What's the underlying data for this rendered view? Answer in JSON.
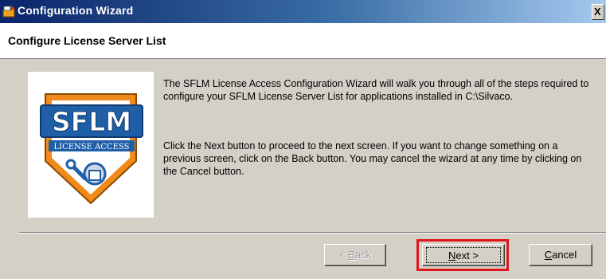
{
  "window": {
    "title": "Configuration Wizard",
    "close_glyph": "X"
  },
  "header": {
    "title": "Configure License Server List"
  },
  "logo": {
    "text": "SFLM",
    "subtext": "LICENSE ACCESS"
  },
  "description": {
    "paragraph1": "The SFLM License Access Configuration Wizard will walk you through all of the steps required to configure your SFLM License Server List for applications installed in C:\\Silvaco.",
    "paragraph2": "Click the Next button to proceed to the next screen. If you want to change something on a previous screen, click on the Back button. You may cancel the wizard at any time by clicking on the Cancel button."
  },
  "buttons": {
    "back": {
      "prefix": "< ",
      "mnemonic": "B",
      "rest": "ack",
      "enabled": false
    },
    "next": {
      "mnemonic": "N",
      "rest": "ext >",
      "enabled": true
    },
    "cancel": {
      "mnemonic": "C",
      "rest": "ancel",
      "enabled": true
    }
  },
  "colors": {
    "title_gradient_start": "#0a246a",
    "title_gradient_end": "#a6caf0",
    "face": "#d4d0c8",
    "highlight": "#e0161c",
    "logo_blue": "#1f5fa8",
    "logo_orange": "#f08a1a"
  }
}
